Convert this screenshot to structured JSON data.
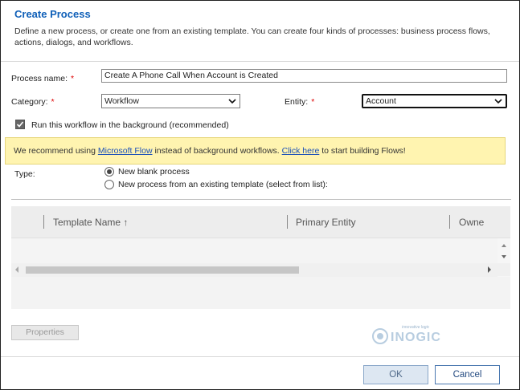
{
  "dialog": {
    "title": "Create Process",
    "description": "Define a new process, or create one from an existing template. You can create four kinds of processes: business process flows, actions, dialogs, and workflows."
  },
  "form": {
    "process_name_label": "Process name:",
    "process_name_value": "Create A Phone Call When Account is Created",
    "category_label": "Category:",
    "category_value": "Workflow",
    "entity_label": "Entity:",
    "entity_value": "Account",
    "required_marker": "*",
    "background_checkbox_label": "Run this workflow in the background (recommended)",
    "background_checked": true
  },
  "banner": {
    "text_before": "We recommend using ",
    "link1": "Microsoft Flow",
    "text_middle": " instead of background workflows. ",
    "link2": "Click here",
    "text_after": " to start building Flows!"
  },
  "type": {
    "label": "Type:",
    "option_blank": "New blank process",
    "option_template": "New process from an existing template (select from list):",
    "selected": "blank"
  },
  "grid": {
    "columns": [
      "Template Name ↑",
      "Primary Entity",
      "Owne"
    ]
  },
  "buttons": {
    "properties": "Properties",
    "ok": "OK",
    "cancel": "Cancel"
  },
  "logo": {
    "tagline": "innovative logic",
    "name": "INOGIC"
  },
  "colors": {
    "title": "#1060b8",
    "banner_bg": "#fff4b0",
    "link": "#1a4fb8"
  }
}
